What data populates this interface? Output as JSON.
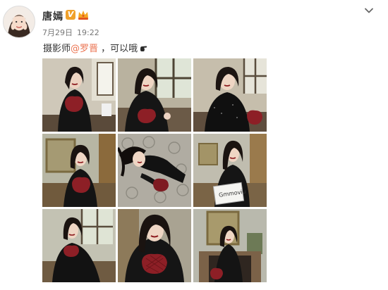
{
  "post": {
    "author": {
      "name": "唐嫣",
      "verified_icon": "verified-v-icon",
      "vip_icon": "vip-crown-icon"
    },
    "date": "7月29日",
    "time": "19:22",
    "text_prefix": "摄影师",
    "mention": "@罗晋",
    "text_suffix": " ，可以哦",
    "text_emoji": "hand-pointing-icon",
    "image_count": 9,
    "colors": {
      "mention": "#eb7350",
      "verified": "#f0a12b",
      "text": "#333333",
      "meta": "#777777"
    }
  },
  "photos": [
    {
      "name": "photo-1",
      "subject": "woman in black holding red bag by window"
    },
    {
      "name": "photo-2",
      "subject": "woman in black leaning by window"
    },
    {
      "name": "photo-3",
      "subject": "woman in black sequin top with red bag"
    },
    {
      "name": "photo-4",
      "subject": "woman seated near mirror holding red bag"
    },
    {
      "name": "photo-5",
      "subject": "woman lying on patterned carpet"
    },
    {
      "name": "photo-6",
      "subject": "woman in black dress holding placard"
    },
    {
      "name": "photo-7",
      "subject": "woman seated in black gown"
    },
    {
      "name": "photo-8",
      "subject": "close portrait holding red bag"
    },
    {
      "name": "photo-9",
      "subject": "woman standing by fireplace"
    }
  ],
  "placard_text": "Gmmoviu"
}
